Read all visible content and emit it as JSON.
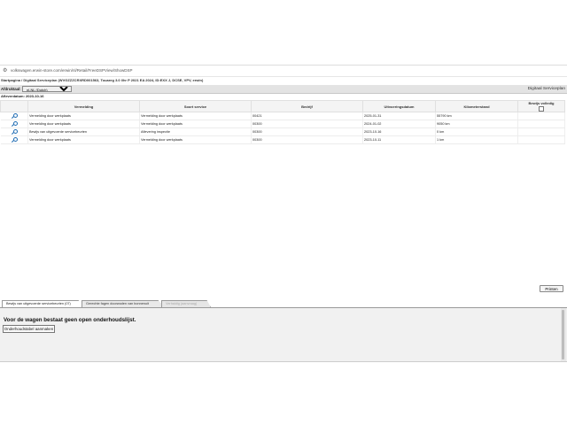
{
  "browser": {
    "url": "volkswagen.erwin-store.com/erwin/nl/Retail/FreeDSPView/ShowDSP"
  },
  "breadcrumb": "Startpagina / Digitaal Serviceplan (WVGZZZCRXRD001563, Touareg 3.0 l/hr P 2021 EA 2024, ID:EXX J, DCSE, VPV, erwin)",
  "toolbar": {
    "country_label": "Afdruktaal:",
    "country_value": "nl-NL (Dutch)",
    "right_title": "Digitaal Serviceplan"
  },
  "date_line": "Afleverdatum: 2023-10-16",
  "table": {
    "headers": [
      "",
      "Vermelding",
      "Soort service",
      "Bedrijf",
      "Uitvoeringsdatum",
      "Kilometerstand",
      "Bewijs volledig"
    ],
    "rows": [
      {
        "vermelding": "Vermelding door werkplaats",
        "soort": "Vermelding door werkplaats",
        "bedrijf": "00421",
        "datum": "2025-01-31",
        "km": "55790 km"
      },
      {
        "vermelding": "Vermelding door werkplaats",
        "soort": "Vermelding door werkplaats",
        "bedrijf": "00300",
        "datum": "2024-01-02",
        "km": "9050 km"
      },
      {
        "vermelding": "Bewijs van uitgevoerde servicebeurten",
        "soort": "Aflevering inspectie",
        "bedrijf": "00300",
        "datum": "2023-10-16",
        "km": "0 km"
      },
      {
        "vermelding": "Vermelding door werkplaats",
        "soort": "Vermelding door werkplaats",
        "bedrijf": "00300",
        "datum": "2023-10-11",
        "km": "1 km"
      }
    ]
  },
  "print_button": "Printen",
  "tabs": [
    "Bewijs van uitgevoerde servicebeurten (07)",
    "Gerechte fagen doorwoden van bonnenuit",
    "Verhaldig (aanvraag)"
  ],
  "panel": {
    "message": "Voor de wagen bestaat geen open onderhoudslijst.",
    "create_button": "Onderhoudstabel aanmaken"
  }
}
